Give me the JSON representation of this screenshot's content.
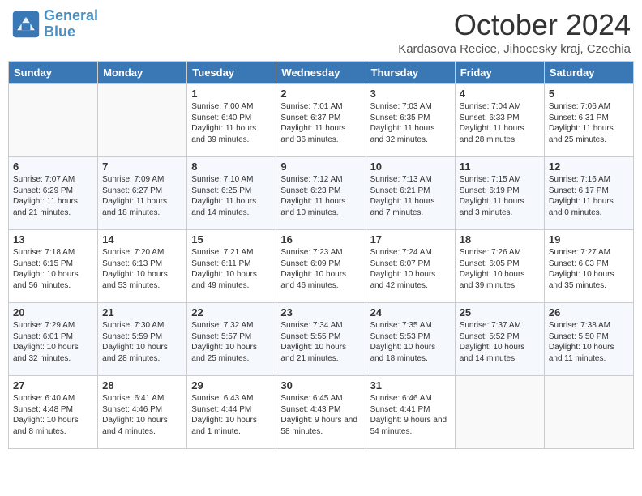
{
  "header": {
    "logo_line1": "General",
    "logo_line2": "Blue",
    "month": "October 2024",
    "location": "Kardasova Recice, Jihocesky kraj, Czechia"
  },
  "weekdays": [
    "Sunday",
    "Monday",
    "Tuesday",
    "Wednesday",
    "Thursday",
    "Friday",
    "Saturday"
  ],
  "weeks": [
    [
      {
        "day": "",
        "info": ""
      },
      {
        "day": "",
        "info": ""
      },
      {
        "day": "1",
        "info": "Sunrise: 7:00 AM\nSunset: 6:40 PM\nDaylight: 11 hours and 39 minutes."
      },
      {
        "day": "2",
        "info": "Sunrise: 7:01 AM\nSunset: 6:37 PM\nDaylight: 11 hours and 36 minutes."
      },
      {
        "day": "3",
        "info": "Sunrise: 7:03 AM\nSunset: 6:35 PM\nDaylight: 11 hours and 32 minutes."
      },
      {
        "day": "4",
        "info": "Sunrise: 7:04 AM\nSunset: 6:33 PM\nDaylight: 11 hours and 28 minutes."
      },
      {
        "day": "5",
        "info": "Sunrise: 7:06 AM\nSunset: 6:31 PM\nDaylight: 11 hours and 25 minutes."
      }
    ],
    [
      {
        "day": "6",
        "info": "Sunrise: 7:07 AM\nSunset: 6:29 PM\nDaylight: 11 hours and 21 minutes."
      },
      {
        "day": "7",
        "info": "Sunrise: 7:09 AM\nSunset: 6:27 PM\nDaylight: 11 hours and 18 minutes."
      },
      {
        "day": "8",
        "info": "Sunrise: 7:10 AM\nSunset: 6:25 PM\nDaylight: 11 hours and 14 minutes."
      },
      {
        "day": "9",
        "info": "Sunrise: 7:12 AM\nSunset: 6:23 PM\nDaylight: 11 hours and 10 minutes."
      },
      {
        "day": "10",
        "info": "Sunrise: 7:13 AM\nSunset: 6:21 PM\nDaylight: 11 hours and 7 minutes."
      },
      {
        "day": "11",
        "info": "Sunrise: 7:15 AM\nSunset: 6:19 PM\nDaylight: 11 hours and 3 minutes."
      },
      {
        "day": "12",
        "info": "Sunrise: 7:16 AM\nSunset: 6:17 PM\nDaylight: 11 hours and 0 minutes."
      }
    ],
    [
      {
        "day": "13",
        "info": "Sunrise: 7:18 AM\nSunset: 6:15 PM\nDaylight: 10 hours and 56 minutes."
      },
      {
        "day": "14",
        "info": "Sunrise: 7:20 AM\nSunset: 6:13 PM\nDaylight: 10 hours and 53 minutes."
      },
      {
        "day": "15",
        "info": "Sunrise: 7:21 AM\nSunset: 6:11 PM\nDaylight: 10 hours and 49 minutes."
      },
      {
        "day": "16",
        "info": "Sunrise: 7:23 AM\nSunset: 6:09 PM\nDaylight: 10 hours and 46 minutes."
      },
      {
        "day": "17",
        "info": "Sunrise: 7:24 AM\nSunset: 6:07 PM\nDaylight: 10 hours and 42 minutes."
      },
      {
        "day": "18",
        "info": "Sunrise: 7:26 AM\nSunset: 6:05 PM\nDaylight: 10 hours and 39 minutes."
      },
      {
        "day": "19",
        "info": "Sunrise: 7:27 AM\nSunset: 6:03 PM\nDaylight: 10 hours and 35 minutes."
      }
    ],
    [
      {
        "day": "20",
        "info": "Sunrise: 7:29 AM\nSunset: 6:01 PM\nDaylight: 10 hours and 32 minutes."
      },
      {
        "day": "21",
        "info": "Sunrise: 7:30 AM\nSunset: 5:59 PM\nDaylight: 10 hours and 28 minutes."
      },
      {
        "day": "22",
        "info": "Sunrise: 7:32 AM\nSunset: 5:57 PM\nDaylight: 10 hours and 25 minutes."
      },
      {
        "day": "23",
        "info": "Sunrise: 7:34 AM\nSunset: 5:55 PM\nDaylight: 10 hours and 21 minutes."
      },
      {
        "day": "24",
        "info": "Sunrise: 7:35 AM\nSunset: 5:53 PM\nDaylight: 10 hours and 18 minutes."
      },
      {
        "day": "25",
        "info": "Sunrise: 7:37 AM\nSunset: 5:52 PM\nDaylight: 10 hours and 14 minutes."
      },
      {
        "day": "26",
        "info": "Sunrise: 7:38 AM\nSunset: 5:50 PM\nDaylight: 10 hours and 11 minutes."
      }
    ],
    [
      {
        "day": "27",
        "info": "Sunrise: 6:40 AM\nSunset: 4:48 PM\nDaylight: 10 hours and 8 minutes."
      },
      {
        "day": "28",
        "info": "Sunrise: 6:41 AM\nSunset: 4:46 PM\nDaylight: 10 hours and 4 minutes."
      },
      {
        "day": "29",
        "info": "Sunrise: 6:43 AM\nSunset: 4:44 PM\nDaylight: 10 hours and 1 minute."
      },
      {
        "day": "30",
        "info": "Sunrise: 6:45 AM\nSunset: 4:43 PM\nDaylight: 9 hours and 58 minutes."
      },
      {
        "day": "31",
        "info": "Sunrise: 6:46 AM\nSunset: 4:41 PM\nDaylight: 9 hours and 54 minutes."
      },
      {
        "day": "",
        "info": ""
      },
      {
        "day": "",
        "info": ""
      }
    ]
  ]
}
